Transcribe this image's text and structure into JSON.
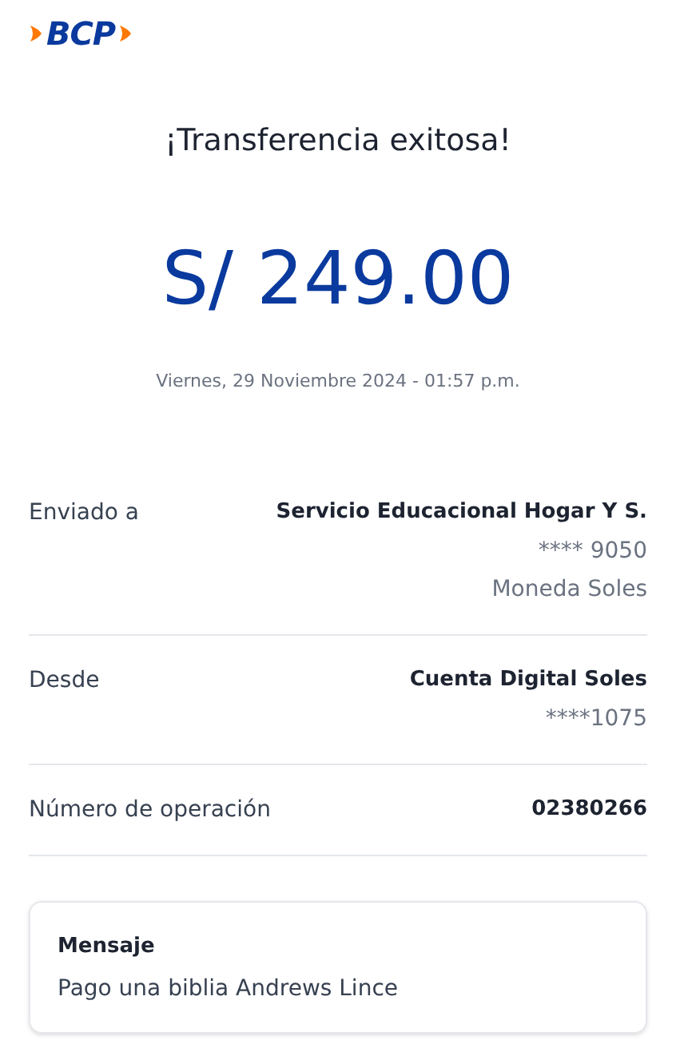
{
  "logo": {
    "text": "BCP"
  },
  "title": "¡Transferencia exitosa!",
  "amount": "S/ 249.00",
  "date": "Viernes, 29 Noviembre 2024 - 01:57 p.m.",
  "details": [
    {
      "label": "Enviado a",
      "lines": [
        {
          "kind": "main",
          "text": "Servicio Educacional Hogar Y S."
        },
        {
          "kind": "sub",
          "text": "**** 9050"
        },
        {
          "kind": "sub",
          "text": "Moneda Soles"
        }
      ]
    },
    {
      "label": "Desde",
      "lines": [
        {
          "kind": "main",
          "text": "Cuenta Digital Soles"
        },
        {
          "kind": "sub",
          "text": "****1075"
        }
      ]
    },
    {
      "label": "Número de operación",
      "lines": [
        {
          "kind": "main",
          "text": "02380266"
        }
      ]
    }
  ],
  "message": {
    "title": "Mensaje",
    "text": "Pago una biblia Andrews Lince"
  }
}
